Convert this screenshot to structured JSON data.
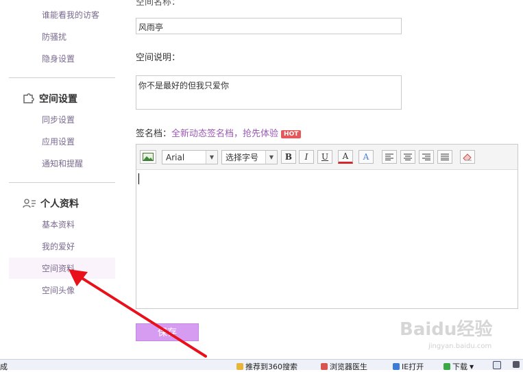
{
  "sidebar": {
    "privacy_items": [
      {
        "label": "谁能看我的访客"
      },
      {
        "label": "防骚扰"
      },
      {
        "label": "隐身设置"
      }
    ],
    "space_settings": {
      "title": "空间设置",
      "items": [
        {
          "label": "同步设置"
        },
        {
          "label": "应用设置"
        },
        {
          "label": "通知和提醒"
        }
      ]
    },
    "personal": {
      "title": "个人资料",
      "items": [
        {
          "label": "基本资料"
        },
        {
          "label": "我的爱好"
        },
        {
          "label": "空间资料",
          "active": true
        },
        {
          "label": "空间头像"
        }
      ]
    }
  },
  "main": {
    "space_name_value": "风雨亭",
    "space_desc_label": "空间说明：",
    "space_desc_value": "你不是最好的但我只爱你",
    "signature_label": "签名档：",
    "signature_link": "全新动态签名档，抢先体验",
    "hot_badge": "HOT",
    "editor": {
      "font_value": "Arial",
      "size_value": "选择字号",
      "bold": "B",
      "italic": "I",
      "underline": "U",
      "font_color": "A",
      "highlight": "A"
    },
    "save_label": "保存"
  },
  "statusbar": {
    "left_text": "成",
    "items": [
      "推荐到360搜索",
      "浏览器医生",
      "IE打开",
      "下载"
    ]
  },
  "watermark": {
    "text": "Baidu经验",
    "sub": "jingyan.baidu.com"
  },
  "colors": {
    "sidebar_link": "#7a6a8f",
    "accent": "#9b59b6",
    "save_button": "#d59cf1",
    "hot_badge": "#e4575b",
    "arrow": "#e8101a"
  }
}
